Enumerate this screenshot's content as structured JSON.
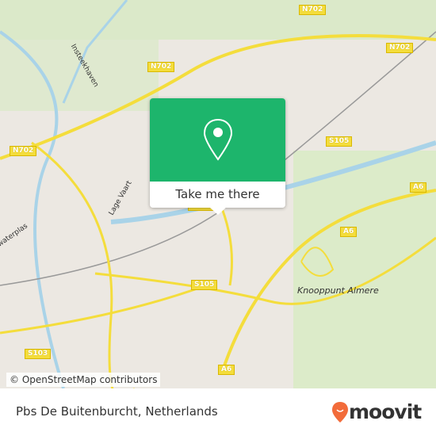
{
  "map": {
    "road_labels": [
      "N702",
      "N702",
      "N702",
      "N702",
      "S105",
      "S105",
      "S105",
      "A6",
      "A6",
      "A6",
      "S103"
    ],
    "place_labels": [
      "Knooppunt Almere",
      "Lage Vaart",
      "Insteekhaven",
      "waterplas"
    ],
    "attribution": "© OpenStreetMap contributors"
  },
  "popup": {
    "button_label": "Take me there",
    "color": "#1db56c",
    "icon": "map-pin-icon"
  },
  "footer": {
    "place_name": "Pbs De Buitenburcht, Netherlands",
    "brand": "moovit",
    "brand_color": "#f26b3a"
  }
}
